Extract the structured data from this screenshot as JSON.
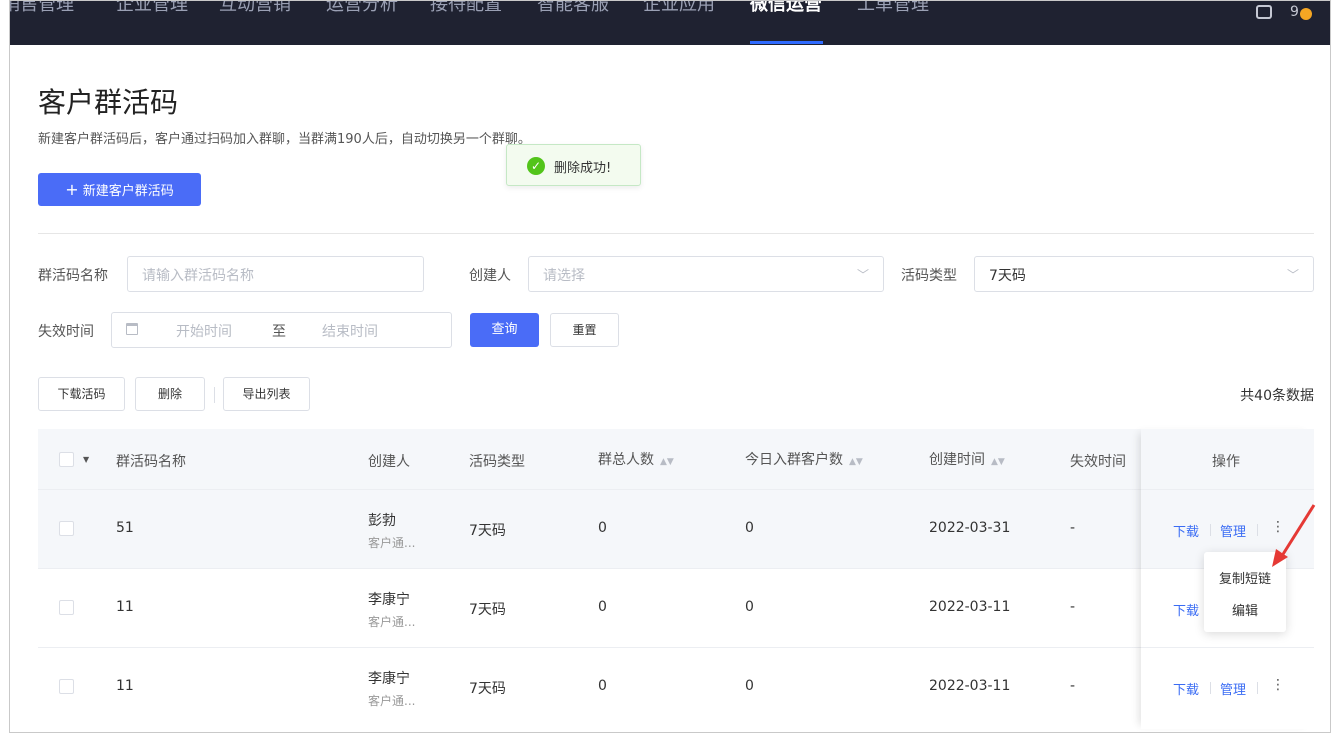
{
  "nav": {
    "items": [
      "销售管理",
      "企业管理",
      "互动营销",
      "运营分析",
      "接待配置",
      "智能客服",
      "企业应用",
      "微信运营",
      "工单管理"
    ],
    "active_index": 7,
    "user": "9"
  },
  "header": {
    "title": "客户群活码",
    "description": "新建客户群活码后，客户通过扫码加入群聊，当群满190人后，自动切换另一个群聊。",
    "new_button": "新建客户群活码"
  },
  "toast": {
    "message": "删除成功!"
  },
  "filters": {
    "name_label": "群活码名称",
    "name_placeholder": "请输入群活码名称",
    "creator_label": "创建人",
    "creator_placeholder": "请选择",
    "type_label": "活码类型",
    "type_value": "7天码",
    "expire_label": "失效时间",
    "start_placeholder": "开始时间",
    "range_sep": "至",
    "end_placeholder": "结束时间",
    "query_button": "查询",
    "reset_button": "重置"
  },
  "actions": {
    "download": "下载活码",
    "delete": "删除",
    "export": "导出列表",
    "total": "共40条数据"
  },
  "table": {
    "headers": {
      "name": "群活码名称",
      "creator": "创建人",
      "type": "活码类型",
      "total_members": "群总人数",
      "today_joined": "今日入群客户数",
      "created": "创建时间",
      "expire": "失效时间",
      "ops": "操作"
    },
    "rows": [
      {
        "name": "51",
        "creator": "彭勃",
        "creator_sub": "客户通...",
        "type": "7天码",
        "total": "0",
        "today": "0",
        "created": "2022-03-31",
        "expire": "-"
      },
      {
        "name": "11",
        "creator": "李康宁",
        "creator_sub": "客户通...",
        "type": "7天码",
        "total": "0",
        "today": "0",
        "created": "2022-03-11",
        "expire": "-"
      },
      {
        "name": "11",
        "creator": "李康宁",
        "creator_sub": "客户通...",
        "type": "7天码",
        "total": "0",
        "today": "0",
        "created": "2022-03-11",
        "expire": "-"
      }
    ],
    "op_download": "下载",
    "op_manage": "管理",
    "op_more": "⋮"
  },
  "dropdown": {
    "items": [
      "复制短链",
      "编辑"
    ]
  },
  "colors": {
    "primary": "#4a6cf7",
    "nav_bg": "#1f2231",
    "success": "#52c41a",
    "annotation_arrow": "#e53935"
  }
}
